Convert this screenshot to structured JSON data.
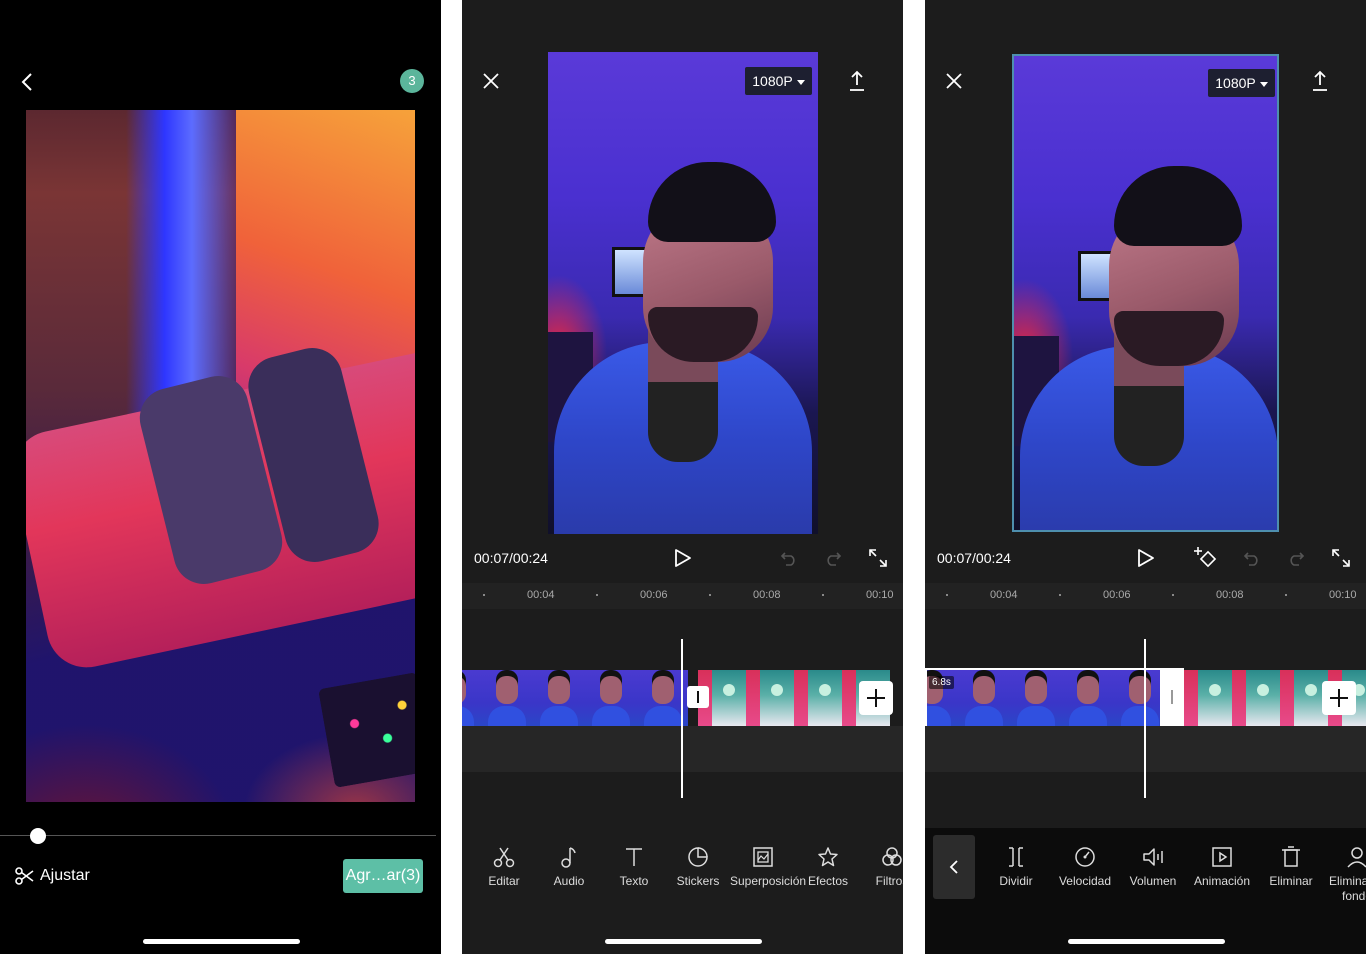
{
  "colors": {
    "accent": "#5bb59b",
    "add_button": "#5dbfa6",
    "selection_border": "#4e8fae",
    "panel_dark": "#1c1c1c"
  },
  "picker": {
    "back_icon": "chevron-left-icon",
    "selected_count": "3",
    "trim_icon": "scissors-icon",
    "trim_label": "Ajustar",
    "add_label": "Agr…ar(3)",
    "scrub_progress": 0.05
  },
  "editor": {
    "close_icon": "close-icon",
    "export_icon": "upload-icon",
    "resolution": "1080P",
    "timecode": "00:07/00:24",
    "ruler": [
      "00:04",
      "00:06",
      "00:08",
      "00:10"
    ],
    "tools": [
      {
        "label": "Editar",
        "icon": "scissors-icon"
      },
      {
        "label": "Audio",
        "icon": "music-note-icon"
      },
      {
        "label": "Texto",
        "icon": "text-icon"
      },
      {
        "label": "Stickers",
        "icon": "sticker-icon"
      },
      {
        "label": "Superposición",
        "icon": "overlay-icon"
      },
      {
        "label": "Efectos",
        "icon": "effects-star-icon"
      },
      {
        "label": "Filtros",
        "icon": "filters-icon"
      }
    ]
  },
  "clip_editor": {
    "close_icon": "close-icon",
    "export_icon": "upload-icon",
    "resolution": "1080P",
    "timecode": "00:07/00:24",
    "ruler": [
      "00:04",
      "00:06",
      "00:08",
      "00:10"
    ],
    "clip_duration": "6.8s",
    "tools": [
      {
        "label": "Dividir",
        "icon": "split-icon"
      },
      {
        "label": "Velocidad",
        "icon": "speed-icon"
      },
      {
        "label": "Volumen",
        "icon": "volume-icon"
      },
      {
        "label": "Animación",
        "icon": "animation-icon"
      },
      {
        "label": "Eliminar",
        "icon": "trash-icon"
      },
      {
        "label": "Eliminar el fondo",
        "icon": "remove-background-icon"
      }
    ]
  }
}
